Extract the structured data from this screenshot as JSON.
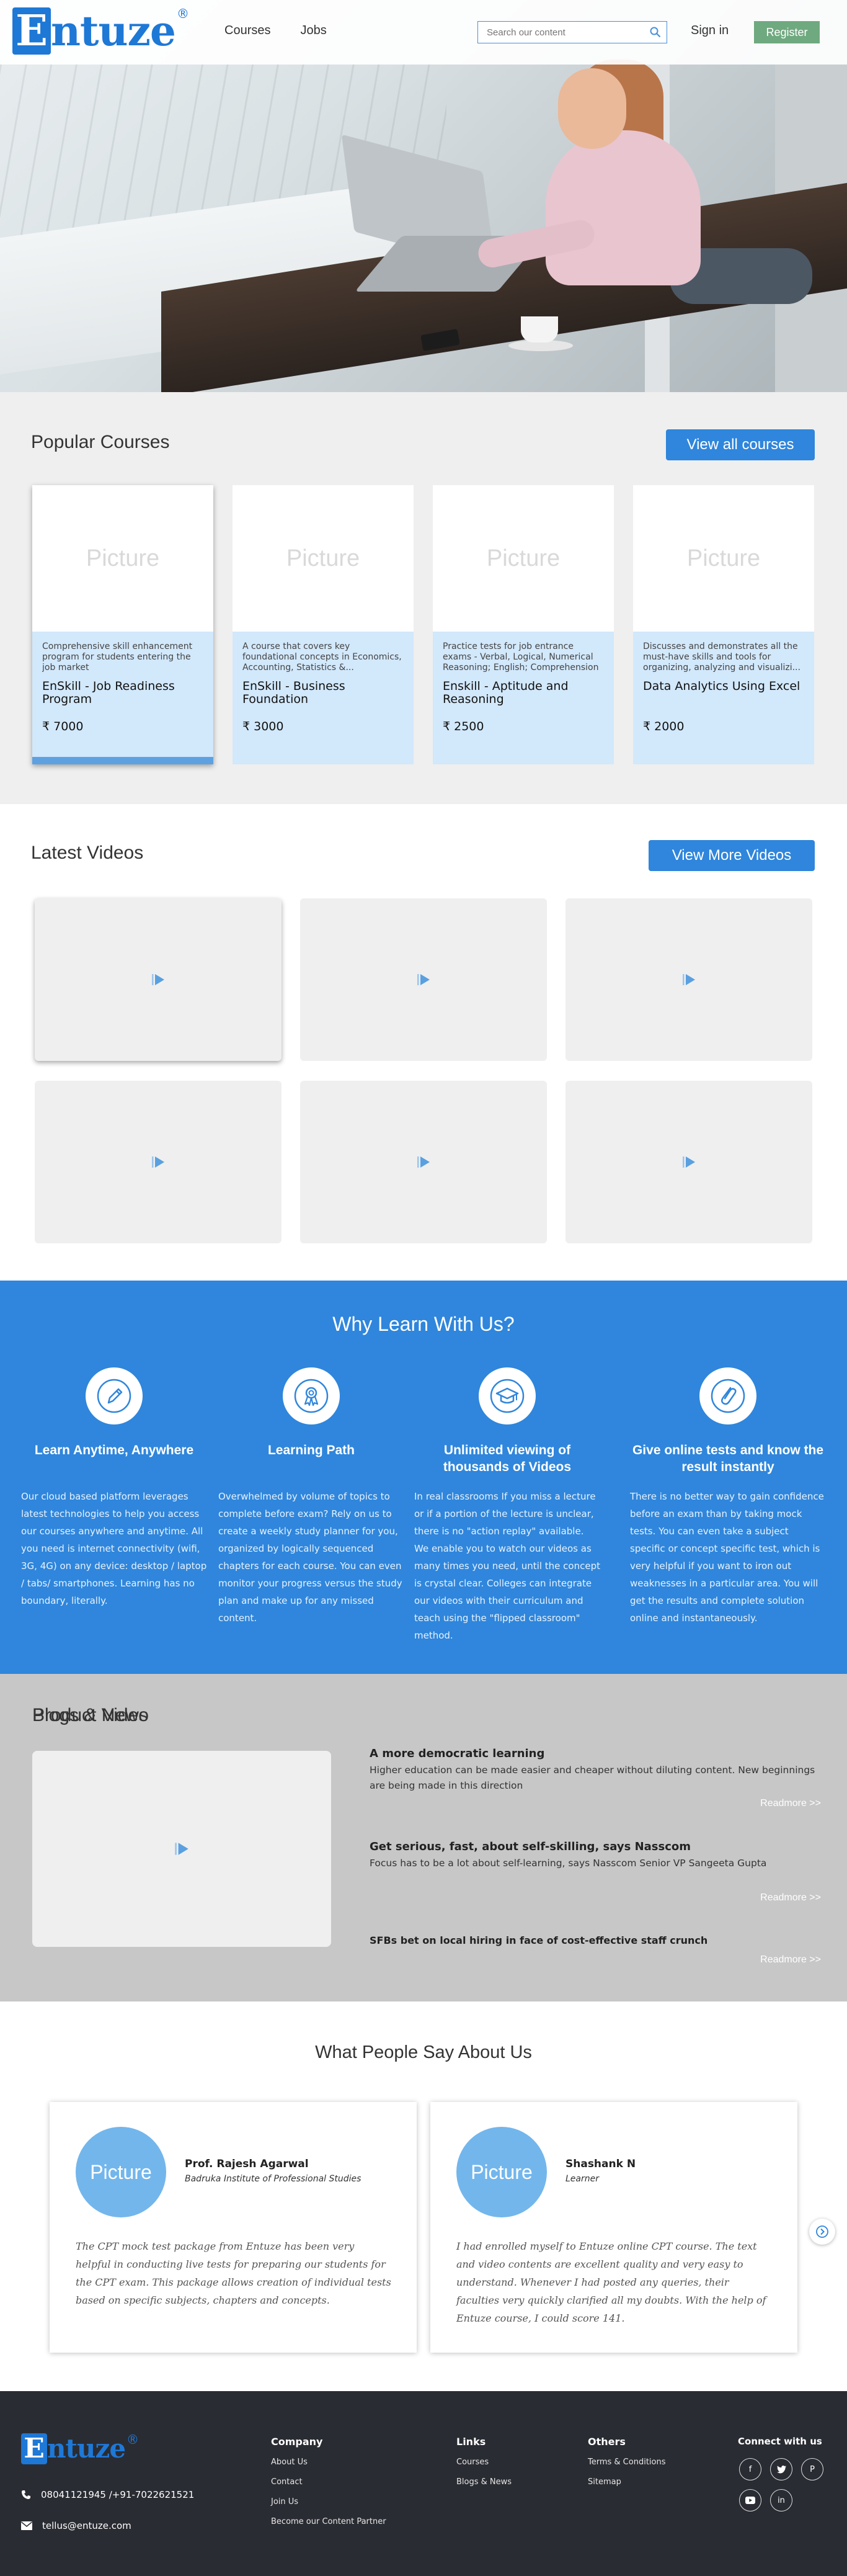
{
  "header": {
    "logo_letter": "E",
    "logo_rest": "ntuze",
    "logo_reg": "®",
    "nav": [
      "Courses",
      "Jobs"
    ],
    "search_placeholder": "Search our content",
    "signin": "Sign in",
    "register": "Register"
  },
  "courses": {
    "title": "Popular Courses",
    "view_all": "View all courses",
    "placeholder": "Picture",
    "items": [
      {
        "desc": "Comprehensive skill enhancement program for students entering the job market",
        "name": "EnSkill - Job Readiness Program",
        "price": "₹ 7000"
      },
      {
        "desc": "A course that covers key foundational concepts in Economics, Accounting, Statistics &...",
        "name": "EnSkill - Business Foundation",
        "price": "₹ 3000"
      },
      {
        "desc": "Practice tests for job entrance exams - Verbal, Logical, Numerical Reasoning; English; Comprehension",
        "name": "Enskill - Aptitude and Reasoning",
        "price": "₹ 2500"
      },
      {
        "desc": "Discusses and demonstrates all the must-have skills and tools for organizing, analyzing and visualizi...",
        "name": "Data Analytics Using Excel",
        "price": "₹ 2000"
      }
    ]
  },
  "videos": {
    "title": "Latest Videos",
    "view_more": "View More Videos"
  },
  "why": {
    "title": "Why Learn With Us?",
    "items": [
      {
        "icon": "pencil-icon",
        "head": "Learn Anytime, Anywhere",
        "text": "Our cloud based platform leverages latest technologies to help you access our courses anywhere and anytime. All you need is internet connectivity (wifi, 3G, 4G) on any device: desktop / laptop / tabs/ smartphones. Learning has no boundary, literally."
      },
      {
        "icon": "award-ribbon-icon",
        "head": "Learning Path",
        "text": "Overwhelmed by volume of topics to complete before exam? Rely on us to create a weekly study planner for you, organized by logically sequenced chapters for each course. You can even monitor your progress versus the study plan and make up for any missed content."
      },
      {
        "icon": "graduation-cap-icon",
        "head": "Unlimited viewing of thousands of Videos",
        "text": "In real classrooms If you miss a lecture or if a portion of the lecture is unclear, there is no \"action replay\" available. We enable you to watch our videos as many times you need, until the concept is crystal clear. Colleges can integrate our videos with their curriculum and teach using the \"flipped classroom\" method."
      },
      {
        "icon": "paperclip-icon",
        "head": "Give online tests and know the result instantly",
        "text": "There is no better way to gain confidence before an exam than by taking mock tests. You can even take a subject specific or concept specific test, which is very helpful if you want to iron out weaknesses in a particular area. You will get the results and complete solution online and instantaneously."
      }
    ]
  },
  "product": {
    "title": "Product Video"
  },
  "blogs": {
    "title": "Blogs & News",
    "readmore": "Readmore >>",
    "items": [
      {
        "head": "A more democratic learning",
        "text": "Higher education can be made easier and cheaper without diluting content. New beginnings are being made in this direction"
      },
      {
        "head": "Get serious, fast, about self-skilling, says Nasscom",
        "text": "Focus has to be a lot about self-learning, says Nasscom Senior VP Sangeeta Gupta"
      },
      {
        "head": "SFBs bet on local hiring in face of cost-effective staff crunch",
        "text": ""
      }
    ]
  },
  "testimonials": {
    "title": "What People Say About Us",
    "placeholder": "Picture",
    "items": [
      {
        "name": "Prof. Rajesh Agarwal",
        "org": "Badruka Institute of Professional Studies",
        "quote": "The CPT mock test package from Entuze has been very helpful in conducting live tests for preparing our students for the CPT exam. This package allows creation of individual tests based on specific subjects, chapters and concepts."
      },
      {
        "name": "Shashank N",
        "org": "Learner",
        "quote": "I had enrolled myself to Entuze online CPT course. The text and video contents are excellent quality and very easy to understand. Whenever I had posted any queries, their faculties very quickly clarified all my doubts. With the help of Entuze course, I could score 141."
      }
    ]
  },
  "footer": {
    "phone": "08041121945 /+91-7022621521",
    "email": "tellus@entuze.com",
    "company": {
      "title": "Company",
      "links": [
        "About Us",
        "Contact",
        "Join Us",
        "Become our Content Partner"
      ]
    },
    "links": {
      "title": "Links",
      "links": [
        "Courses",
        "Blogs & News"
      ]
    },
    "others": {
      "title": "Others",
      "links": [
        "Terms & Conditions",
        "Sitemap"
      ]
    },
    "connect": {
      "title": "Connect with us",
      "icons": [
        "facebook-icon",
        "twitter-icon",
        "pinterest-icon",
        "youtube-icon",
        "linkedin-icon"
      ]
    }
  },
  "colors": {
    "brand": "#1e78d6",
    "accent": "#2f86dc",
    "register": "#6fa97f",
    "footer": "#2a2c33"
  }
}
